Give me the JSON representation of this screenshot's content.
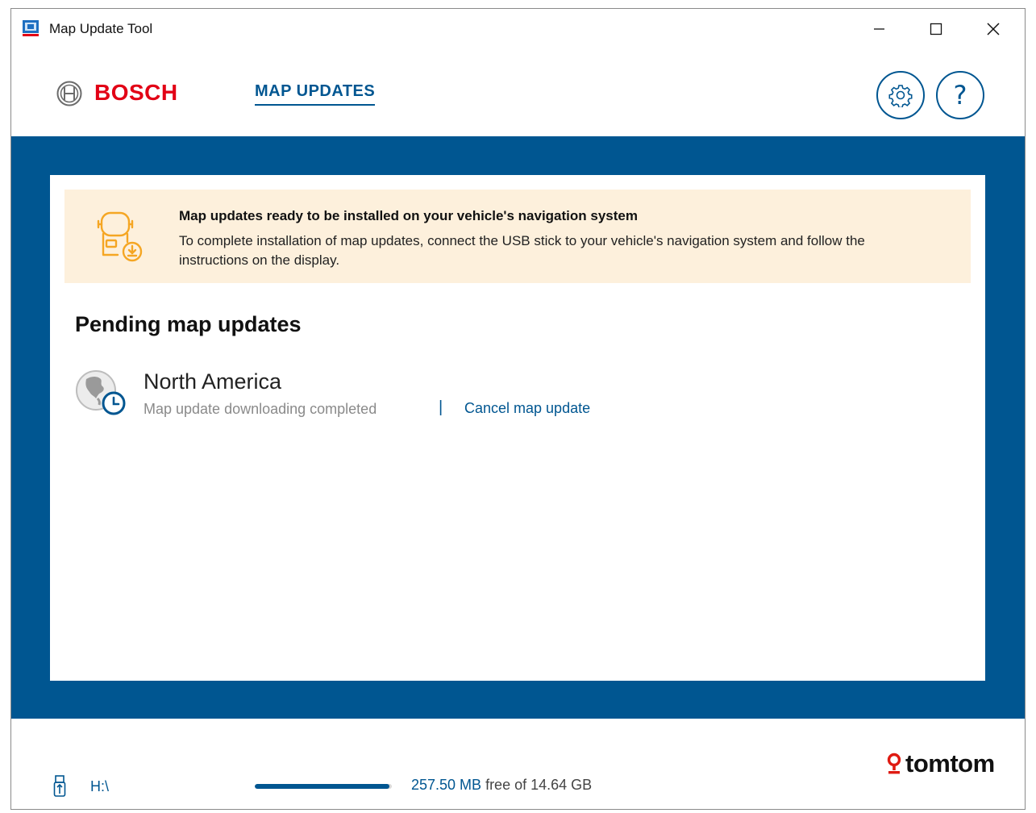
{
  "window": {
    "title": "Map Update Tool",
    "minimize_icon": "minimize-icon",
    "maximize_icon": "maximize-icon",
    "close_icon": "close-icon"
  },
  "header": {
    "brand": "BOSCH",
    "nav_tab": "MAP UPDATES",
    "settings_icon": "gear-icon",
    "help_label": "?"
  },
  "notice": {
    "title": "Map updates ready to be installed on your vehicle's navigation system",
    "text": "To complete installation of map updates, connect the USB stick to your vehicle's navigation system and follow the instructions on the display.",
    "icon": "usb-install-icon"
  },
  "pending": {
    "section_title": "Pending map updates",
    "items": [
      {
        "region": "North America",
        "status": "Map update downloading completed",
        "separator": "|",
        "action": "Cancel map update",
        "icon": "globe-clock-icon"
      }
    ]
  },
  "footer": {
    "provider": "tomtom",
    "drive": "H:\\",
    "storage_free": "257.50 MB",
    "storage_rest": " free of 14.64 GB",
    "storage_used_fraction": 0.98
  },
  "colors": {
    "accent": "#005691",
    "bosch_red": "#e20015",
    "notice_bg": "#fdf0dc",
    "notice_icon": "#f5a623",
    "tomtom_red": "#df1b12"
  }
}
